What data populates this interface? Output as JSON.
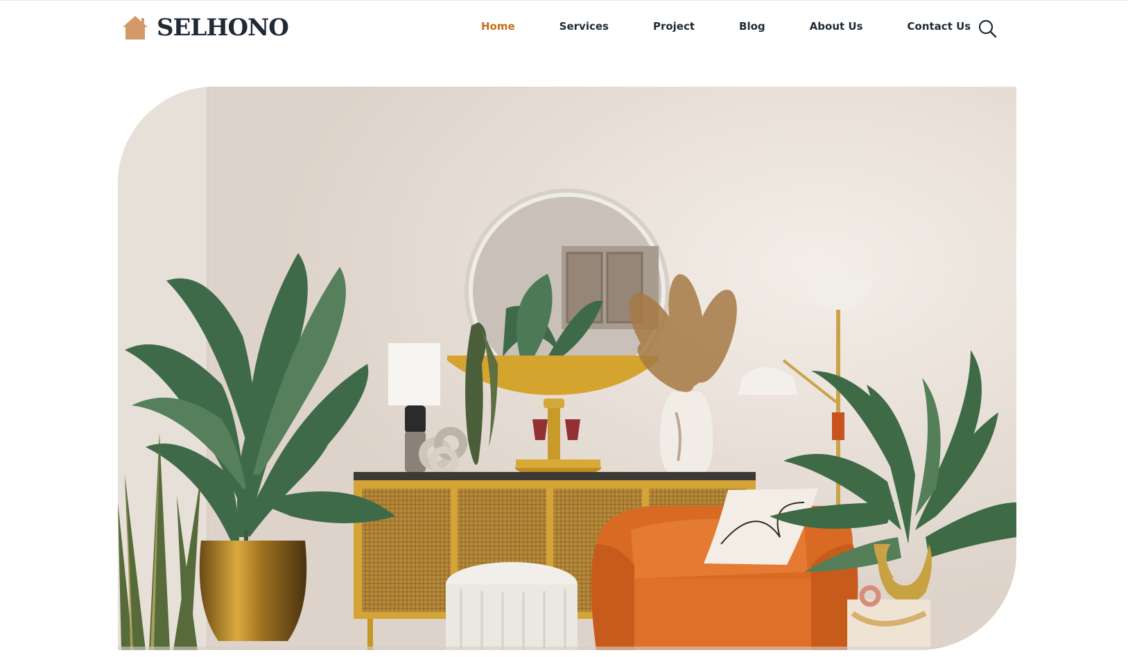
{
  "brand": {
    "name": "SELHONO",
    "icon": "house-icon",
    "icon_color": "#d39a68"
  },
  "nav": {
    "items": [
      {
        "label": "Home",
        "active": true
      },
      {
        "label": "Services",
        "active": false
      },
      {
        "label": "Project",
        "active": false
      },
      {
        "label": "Blog",
        "active": false
      },
      {
        "label": "About Us",
        "active": false
      },
      {
        "label": "Contact Us",
        "active": false
      }
    ],
    "active_color": "#c46f1a",
    "text_color": "#1f2a35"
  },
  "search": {
    "icon": "search-icon"
  },
  "hero": {
    "image": "living-room-hero-image"
  }
}
